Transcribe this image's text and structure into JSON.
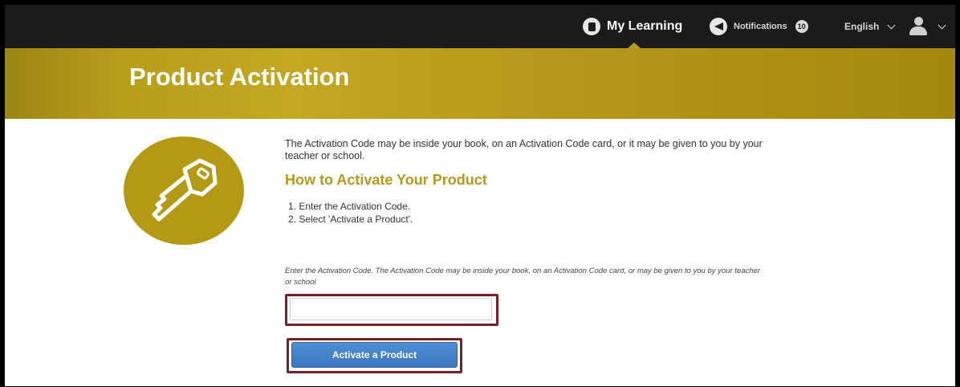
{
  "nav": {
    "my_learning": "My Learning",
    "notifications_label": "Notifications",
    "notifications_count": "10",
    "language": "English",
    "icons": {
      "my_learning": "book-icon",
      "notifications": "megaphone-icon",
      "user": "user-avatar-icon"
    }
  },
  "header": {
    "title": "Product Activation"
  },
  "main": {
    "intro": "The Activation Code may be inside your book, on an Activation Code card, or it may be given to you by your teacher or school.",
    "how_title": "How to Activate Your Product",
    "steps": [
      "1.  Enter the Activation Code.",
      "2.  Select 'Activate a Product'."
    ],
    "field_label": "Enter the Activation Code. The Activation Code may be inside your book, on an Activation Code card, or may be given to you by your teacher or school",
    "code_input_value": "",
    "activate_button": "Activate a Product",
    "icon": "key-icon"
  },
  "colors": {
    "nav_bg": "#1b1b1b",
    "gold": "#b89d1c",
    "heading_gold": "#b8981a",
    "button_blue": "#3b76c0",
    "highlight_outline": "#7a2024"
  }
}
